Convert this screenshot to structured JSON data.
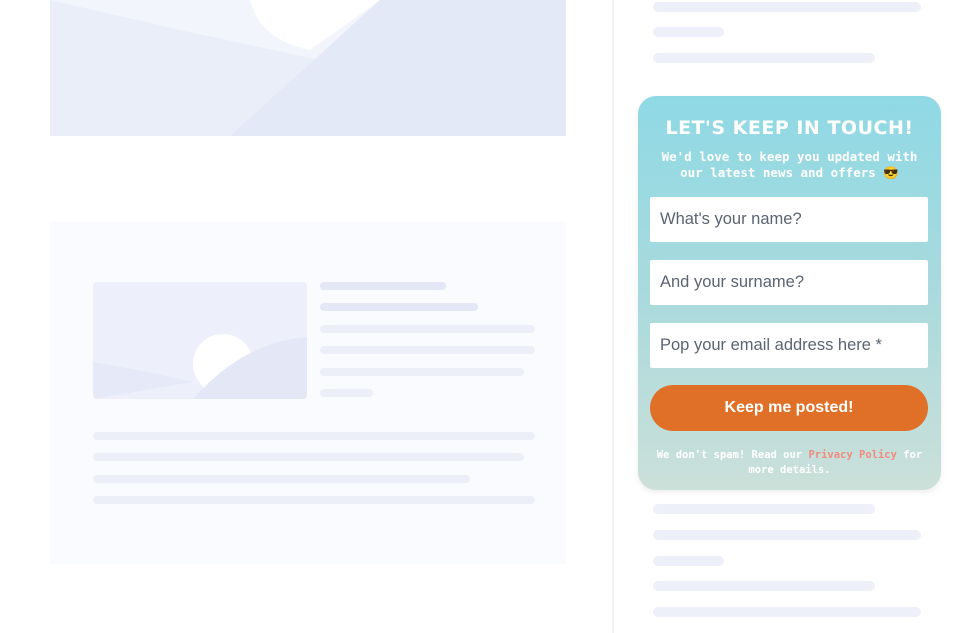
{
  "signup": {
    "title": "LET'S KEEP IN TOUCH!",
    "subtitle": "We'd love to keep you updated with our latest news and offers",
    "emoji": "😎",
    "fields": [
      {
        "placeholder": "What's your name?"
      },
      {
        "placeholder": "And your surname?"
      },
      {
        "placeholder": "Pop your email address here *"
      }
    ],
    "submit_label": "Keep me posted!",
    "legal_prefix": "We don't spam! Read our ",
    "legal_link": "Privacy Policy",
    "legal_suffix": " for more details."
  },
  "colors": {
    "gradient_top": "#8fd9e5",
    "gradient_bottom": "#cbe0d9",
    "button": "#e07028",
    "link": "#f28a7e"
  }
}
